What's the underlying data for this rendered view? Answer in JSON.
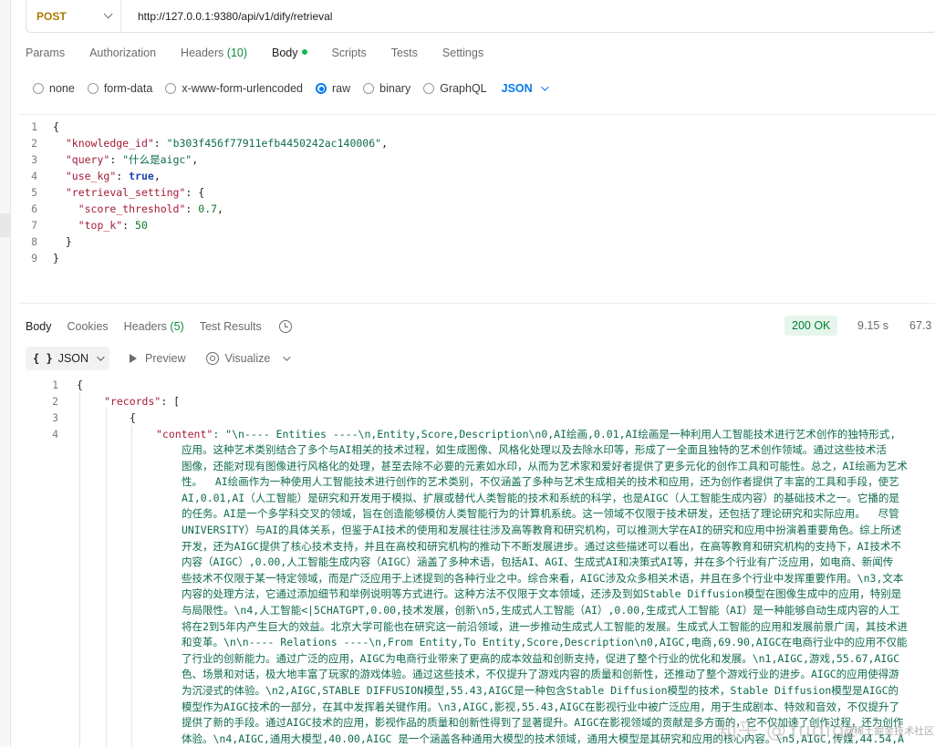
{
  "request": {
    "method": "POST",
    "url": "http://127.0.0.1:9380/api/v1/dify/retrieval",
    "tabs": [
      {
        "label": "Params"
      },
      {
        "label": "Authorization"
      },
      {
        "label": "Headers",
        "count": "(10)"
      },
      {
        "label": "Body"
      },
      {
        "label": "Scripts"
      },
      {
        "label": "Tests"
      },
      {
        "label": "Settings"
      }
    ],
    "active_tab": "Body",
    "body_types": [
      "none",
      "form-data",
      "x-www-form-urlencoded",
      "raw",
      "binary",
      "GraphQL"
    ],
    "selected_body_type": "raw",
    "language": "JSON",
    "body_lines": [
      {
        "n": "1",
        "text": "{"
      },
      {
        "n": "2",
        "key": "\"knowledge_id\"",
        "value": "\"b303f456f77911efb4450242ac140006\"",
        "suffix": ","
      },
      {
        "n": "3",
        "key": "\"query\"",
        "value": "\"什么是aigc\"",
        "suffix": ","
      },
      {
        "n": "4",
        "key": "\"use_kg\"",
        "value": "true",
        "suffix": ","
      },
      {
        "n": "5",
        "key": "\"retrieval_setting\"",
        "value": "{",
        "suffix": ""
      },
      {
        "n": "6",
        "key": "\"score_threshold\"",
        "value": "0.7",
        "suffix": ","
      },
      {
        "n": "7",
        "key": "\"top_k\"",
        "value": "50",
        "suffix": ""
      },
      {
        "n": "8",
        "text": "}"
      },
      {
        "n": "9",
        "text": "}"
      }
    ]
  },
  "response": {
    "tabs": [
      {
        "label": "Body"
      },
      {
        "label": "Cookies"
      },
      {
        "label": "Headers",
        "count": "(5)"
      },
      {
        "label": "Test Results"
      }
    ],
    "status": "200 OK",
    "time": "9.15 s",
    "size": "67.3",
    "format": "JSON",
    "tools": [
      "Preview",
      "Visualize"
    ],
    "line_numbers": [
      "1",
      "2",
      "3",
      "4"
    ],
    "line1": "{",
    "line2_key": "\"records\"",
    "line2_rest": ": [",
    "line3": "{",
    "line4_key": "\"content\"",
    "line4_value": ": \"\\n---- Entities ----\\n,Entity,Score,Description\\n0,AI绘画,0.01,AI绘画是一种利用人工智能技术进行艺术创作的独特形式,",
    "content_wrapped": [
      "应用。这种艺术类别结合了多个与AI相关的技术过程，如生成图像、风格化处理以及去除水印等，形成了一全面且独特的艺术创作领域。通过这些技术活",
      "图像，还能对现有图像进行风格化的处理，甚至去除不必要的元素如水印，从而为艺术家和爱好者提供了更多元化的创作工具和可能性。总之，AI绘画为艺术",
      "性。  AI绘画作为一种使用人工智能技术进行创作的艺术类别，不仅涵盖了多种与艺术生成相关的技术和应用，还为创作者提供了丰富的工具和手段，使艺",
      "AI,0.01,AI（人工智能）是研究和开发用于模拟、扩展或替代人类智能的技术和系统的科学，也是AIGC（人工智能生成内容）的基础技术之一。它播的是",
      "的任务。AI是一个多学科交叉的领域，旨在创造能够模仿人类智能行为的计算机系统。这一领域不仅限于技术研发，还包括了理论研究和实际应用。  尽管",
      "UNIVERSITY）与AI的具体关系，但鉴于AI技术的使用和发展往往涉及高等教育和研究机构，可以推测大学在AI的研究和应用中扮演着重要角色。综上所述",
      "开发，还为AIGC提供了核心技术支持，并且在高校和研究机构的推动下不断发展进步。通过这些描述可以看出，在高等教育和研究机构的支持下，AI技术不",
      "内容（AIGC）,0.00,人工智能生成内容（AIGC）涵盖了多种术语，包括AI、AGI、生成式AI和决策式AI等，并在多个行业有广泛应用，如电商、新闻传",
      "些技术不仅限于某一特定领域，而是广泛应用于上述提到的各种行业之中。综合来看，AIGC涉及众多相关术语，并且在多个行业中发挥重要作用。\\n3,文本",
      "内容的处理方法，它通过添加细节和举例说明等方式进行。这种方法不仅限于文本领域，还涉及到如Stable Diffusion模型在图像生成中的应用，特别是",
      "与局限性。\\n4,人工智能<|5CHATGPT,0.00,技术发展，创新\\n5,生成式人工智能（AI）,0.00,生成式人工智能（AI）是一种能够自动生成内容的人工",
      "将在2到5年内产生巨大的效益。北京大学可能也在研究这一前沿领域，进一步推动生成式人工智能的发展。生成式人工智能的应用和发展前景广阔，其技术进",
      "和变革。\\n\\n---- Relations ----\\n,From Entity,To Entity,Score,Description\\n0,AIGC,电商,69.90,AIGC在电商行业中的应用不仅能",
      "了行业的创新能力。通过广泛的应用，AIGC为电商行业带来了更高的成本效益和创新支持，促进了整个行业的优化和发展。\\n1,AIGC,游戏,55.67,AIGC",
      "色、场景和对话，极大地丰富了玩家的游戏体验。通过这些技术，不仅提升了游戏内容的质量和创新性，还推动了整个游戏行业的进步。AIGC的应用使得游",
      "为沉浸式的体验。\\n2,AIGC,STABLE DIFFUSION模型,55.43,AIGC是一种包含Stable Diffusion模型的技术，Stable Diffusion模型是AIGC的",
      "模型作为AIGC技术的一部分，在其中发挥着关键作用。\\n3,AIGC,影视,55.43,AIGC在影视行业中被广泛应用，用于生成剧本、特效和音效，不仅提升了",
      "提供了新的手段。通过AIGC技术的应用，影视作品的质量和创新性得到了显著提升。AIGC在影视领域的贡献是多方面的，它不仅加速了创作过程，还为创作",
      "体验。\\n4,AIGC,通用大模型,40.00,AIGC 是一个涵盖各种通用大模型的技术领域，通用大模型是其研究和应用的核心内容。\\n5,AIGC,传媒,44.54,A"
    ]
  },
  "watermark": "知乎 @Yuqigz",
  "watermark_small": "@稀土掘金技术社区"
}
